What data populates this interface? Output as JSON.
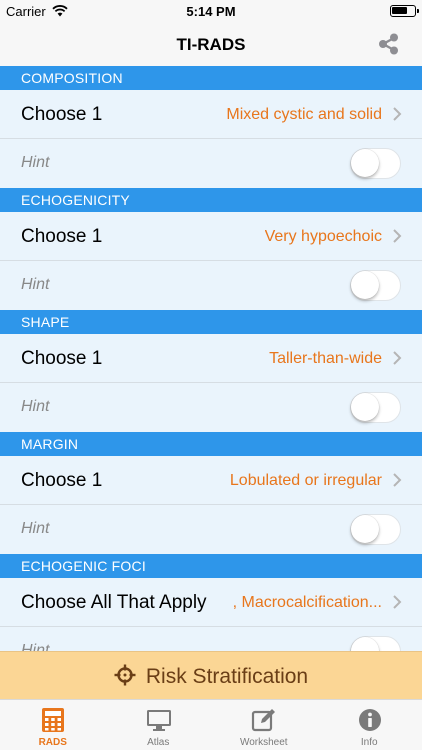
{
  "status_bar": {
    "carrier": "Carrier",
    "time": "5:14 PM"
  },
  "nav": {
    "title": "TI-RADS",
    "share_icon": "share-icon"
  },
  "sections": [
    {
      "header": "COMPOSITION",
      "choose_label": "Choose 1",
      "value": "Mixed cystic and solid",
      "hint_label": "Hint",
      "hint_on": false
    },
    {
      "header": "ECHOGENICITY",
      "choose_label": "Choose 1",
      "value": "Very hypoechoic",
      "hint_label": "Hint",
      "hint_on": false
    },
    {
      "header": "SHAPE",
      "choose_label": "Choose 1",
      "value": "Taller-than-wide",
      "hint_label": "Hint",
      "hint_on": false
    },
    {
      "header": "MARGIN",
      "choose_label": "Choose 1",
      "value": "Lobulated or irregular",
      "hint_label": "Hint",
      "hint_on": false
    },
    {
      "header": "ECHOGENIC FOCI",
      "choose_label": "Choose All That Apply",
      "value": ", Macrocalcification...",
      "hint_label": "Hint",
      "hint_on": false
    }
  ],
  "risk_button": {
    "label": "Risk Stratification",
    "icon": "crosshair-icon"
  },
  "tabs": [
    {
      "label": "RADS",
      "icon": "calculator-icon",
      "active": true
    },
    {
      "label": "Atlas",
      "icon": "monitor-icon",
      "active": false
    },
    {
      "label": "Worksheet",
      "icon": "edit-icon",
      "active": false
    },
    {
      "label": "Info",
      "icon": "info-icon",
      "active": false
    }
  ],
  "colors": {
    "accent": "#2e96ea",
    "value": "#e8761c",
    "row_bg": "#eaf4fc",
    "risk_bg": "#fbd695",
    "risk_text": "#6a3e16",
    "tab_active": "#e8761c"
  }
}
